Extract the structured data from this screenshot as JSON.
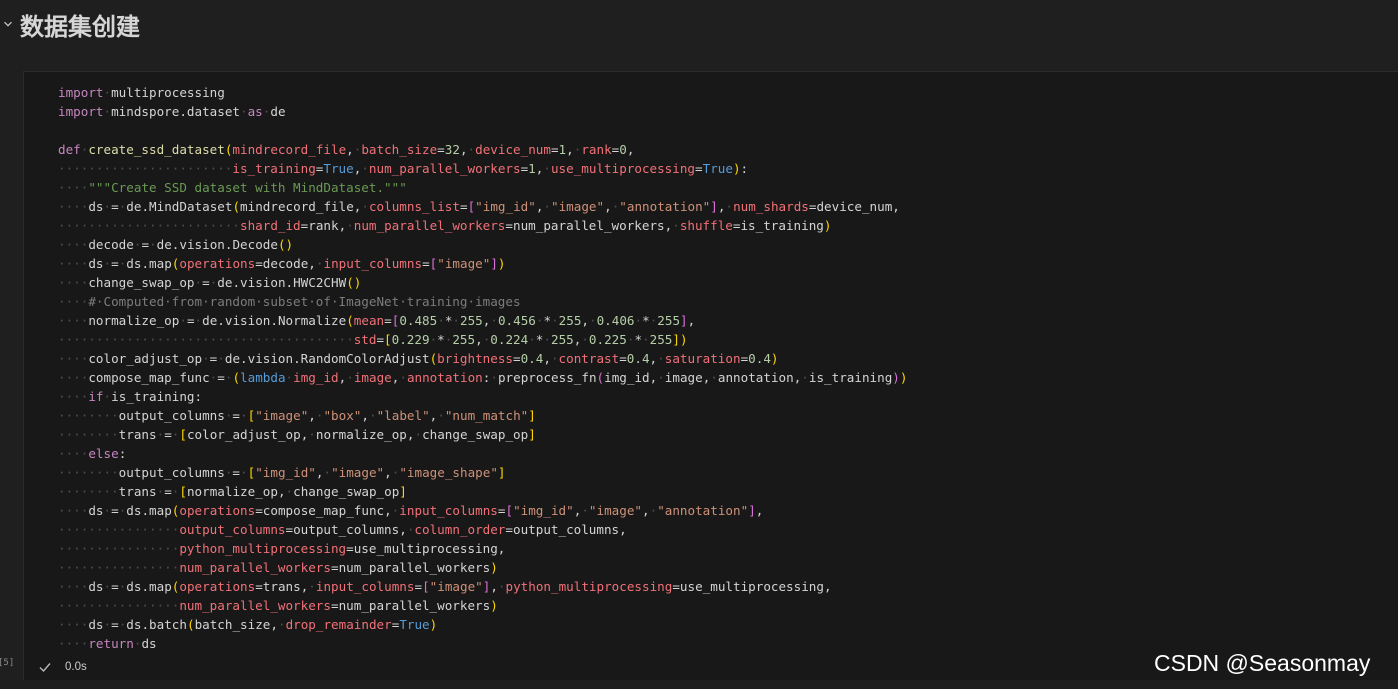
{
  "heading": {
    "title": "数据集创建",
    "icon": "chevron-down-icon"
  },
  "cell": {
    "execution_count": "[5]",
    "status_icon": "check-icon",
    "duration": "0.0s",
    "code_lines": [
      "import multiprocessing",
      "import mindspore.dataset as de",
      "",
      "def create_ssd_dataset(mindrecord_file, batch_size=32, device_num=1, rank=0,",
      "                       is_training=True, num_parallel_workers=1, use_multiprocessing=True):",
      "    \"\"\"Create SSD dataset with MindDataset.\"\"\"",
      "    ds = de.MindDataset(mindrecord_file, columns_list=[\"img_id\", \"image\", \"annotation\"], num_shards=device_num,",
      "                        shard_id=rank, num_parallel_workers=num_parallel_workers, shuffle=is_training)",
      "    decode = de.vision.Decode()",
      "    ds = ds.map(operations=decode, input_columns=[\"image\"])",
      "    change_swap_op = de.vision.HWC2CHW()",
      "    # Computed from random subset of ImageNet training images",
      "    normalize_op = de.vision.Normalize(mean=[0.485 * 255, 0.456 * 255, 0.406 * 255],",
      "                                       std=[0.229 * 255, 0.224 * 255, 0.225 * 255])",
      "    color_adjust_op = de.vision.RandomColorAdjust(brightness=0.4, contrast=0.4, saturation=0.4)",
      "    compose_map_func = (lambda img_id, image, annotation: preprocess_fn(img_id, image, annotation, is_training))",
      "    if is_training:",
      "        output_columns = [\"image\", \"box\", \"label\", \"num_match\"]",
      "        trans = [color_adjust_op, normalize_op, change_swap_op]",
      "    else:",
      "        output_columns = [\"img_id\", \"image\", \"image_shape\"]",
      "        trans = [normalize_op, change_swap_op]",
      "    ds = ds.map(operations=compose_map_func, input_columns=[\"img_id\", \"image\", \"annotation\"],",
      "                output_columns=output_columns, column_order=output_columns,",
      "                python_multiprocessing=use_multiprocessing,",
      "                num_parallel_workers=num_parallel_workers)",
      "    ds = ds.map(operations=trans, input_columns=[\"image\"], python_multiprocessing=use_multiprocessing,",
      "                num_parallel_workers=num_parallel_workers)",
      "    ds = ds.batch(batch_size, drop_remainder=True)",
      "    return ds"
    ]
  },
  "watermark": "CSDN @Seasonmay",
  "colors": {
    "keyword": "#c586c0",
    "keyword_blue": "#569cd6",
    "function": "#dcdcaa",
    "parameter": "#f07178",
    "number": "#b5cea8",
    "string": "#ce9178",
    "comment": "#6a9955",
    "whitespace_dots": "#4e4e4e",
    "bracket": "#ffd700"
  }
}
